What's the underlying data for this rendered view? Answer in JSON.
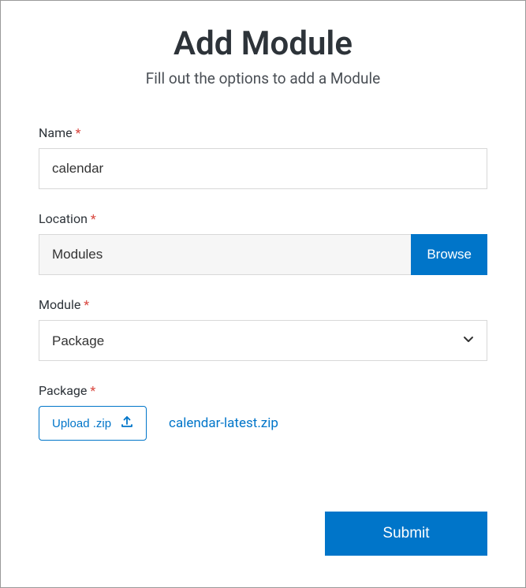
{
  "header": {
    "title": "Add Module",
    "subtitle": "Fill out the options to add a Module"
  },
  "form": {
    "name": {
      "label": "Name",
      "required": "*",
      "value": "calendar"
    },
    "location": {
      "label": "Location",
      "required": "*",
      "value": "Modules",
      "browse_label": "Browse"
    },
    "module": {
      "label": "Module",
      "required": "*",
      "value": "Package"
    },
    "package": {
      "label": "Package",
      "required": "*",
      "upload_label": "Upload .zip",
      "filename": "calendar-latest.zip"
    },
    "submit_label": "Submit"
  }
}
